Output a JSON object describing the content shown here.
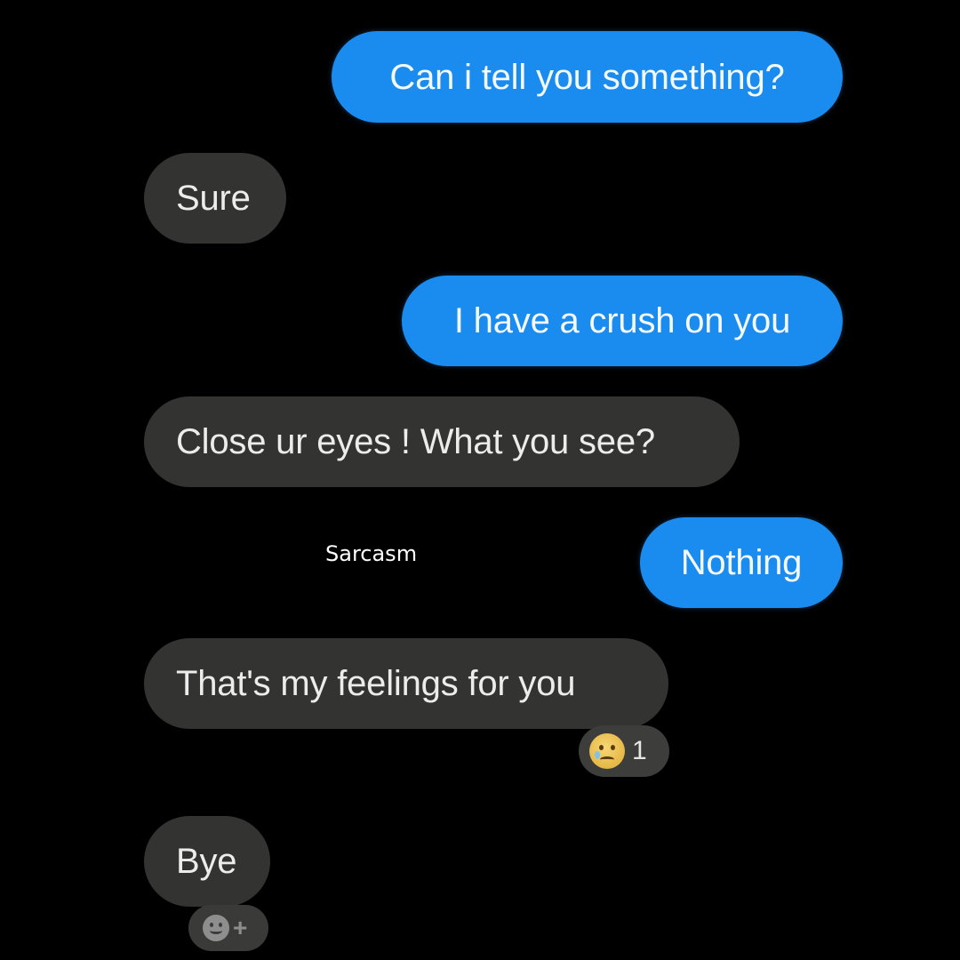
{
  "messages": [
    {
      "side": "sent",
      "text": "Can i tell you something?"
    },
    {
      "side": "received",
      "text": "Sure"
    },
    {
      "side": "sent",
      "text": "I have a crush on you"
    },
    {
      "side": "received",
      "text": "Close ur eyes ! What you see?"
    },
    {
      "side": "sent",
      "text": "Nothing"
    },
    {
      "side": "received",
      "text": "That's my feelings for you"
    },
    {
      "side": "received",
      "text": "Bye"
    }
  ],
  "reaction": {
    "emoji": "crying-face",
    "count": "1"
  },
  "add_reaction": {
    "icon": "smiley-plus-icon",
    "plus": "+"
  },
  "watermark": "Sarcasm",
  "colors": {
    "background": "#000000",
    "sent_bubble": "#1a8cf0",
    "received_bubble": "#333432",
    "text": "#ececec"
  }
}
